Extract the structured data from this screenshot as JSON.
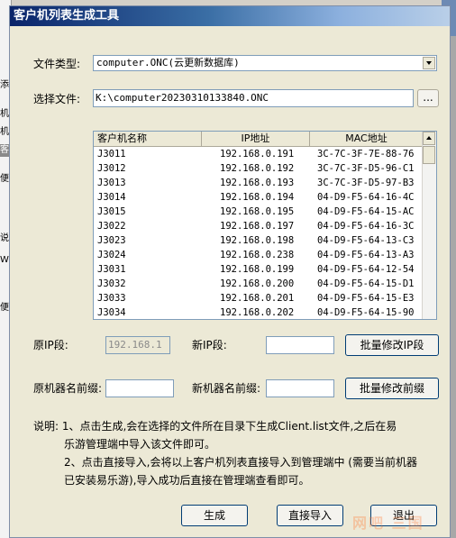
{
  "dialog": {
    "title": "客户机列表生成工具"
  },
  "form": {
    "file_type_label": "文件类型:",
    "file_type_value": "computer.ONC(云更新数据库)",
    "select_file_label": "选择文件:",
    "select_file_value": "K:\\computer20230310133840.ONC",
    "browse_label": "...",
    "orig_ip_label": "原IP段:",
    "orig_ip_value": "192.168.1",
    "new_ip_label": "新IP段:",
    "new_ip_value": "",
    "batch_ip_button": "批量修改IP段",
    "orig_prefix_label": "原机器名前缀:",
    "orig_prefix_value": "",
    "new_prefix_label": "新机器名前缀:",
    "new_prefix_value": "",
    "batch_prefix_button": "批量修改前缀"
  },
  "table": {
    "columns": [
      "客户机名称",
      "IP地址",
      "MAC地址"
    ],
    "rows": [
      [
        "J3011",
        "192.168.0.191",
        "3C-7C-3F-7E-88-76"
      ],
      [
        "J3012",
        "192.168.0.192",
        "3C-7C-3F-D5-96-C1"
      ],
      [
        "J3013",
        "192.168.0.193",
        "3C-7C-3F-D5-97-B3"
      ],
      [
        "J3014",
        "192.168.0.194",
        "04-D9-F5-64-16-4C"
      ],
      [
        "J3015",
        "192.168.0.195",
        "04-D9-F5-64-15-AC"
      ],
      [
        "J3022",
        "192.168.0.197",
        "04-D9-F5-64-16-3C"
      ],
      [
        "J3023",
        "192.168.0.198",
        "04-D9-F5-64-13-C3"
      ],
      [
        "J3024",
        "192.168.0.238",
        "04-D9-F5-64-13-A3"
      ],
      [
        "J3031",
        "192.168.0.199",
        "04-D9-F5-64-12-54"
      ],
      [
        "J3032",
        "192.168.0.200",
        "04-D9-F5-64-15-D1"
      ],
      [
        "J3033",
        "192.168.0.201",
        "04-D9-F5-64-15-E3"
      ],
      [
        "J3034",
        "192.168.0.202",
        "04-D9-F5-64-15-90"
      ]
    ]
  },
  "description": {
    "line1": "说明: 1、点击生成,会在选择的文件所在目录下生成Client.list文件,之后在易",
    "line2": "乐游管理端中导入该文件即可。",
    "line3": "2、点击直接导入,会将以上客户机列表直接导入到管理端中 (需要当前机器",
    "line4": "已安装易乐游),导入成功后直接在管理端查看即可。"
  },
  "buttons": {
    "generate": "生成",
    "direct_import": "直接导入",
    "exit": "退出"
  },
  "watermark": "网吧 三国",
  "background_fragments": [
    "添",
    "机",
    "机",
    "客",
    "便",
    "说",
    "W",
    "便"
  ],
  "colors": {
    "title_bar_start": "#0a246a",
    "window_bg": "#ece9d6",
    "button_border": "#003c74"
  }
}
